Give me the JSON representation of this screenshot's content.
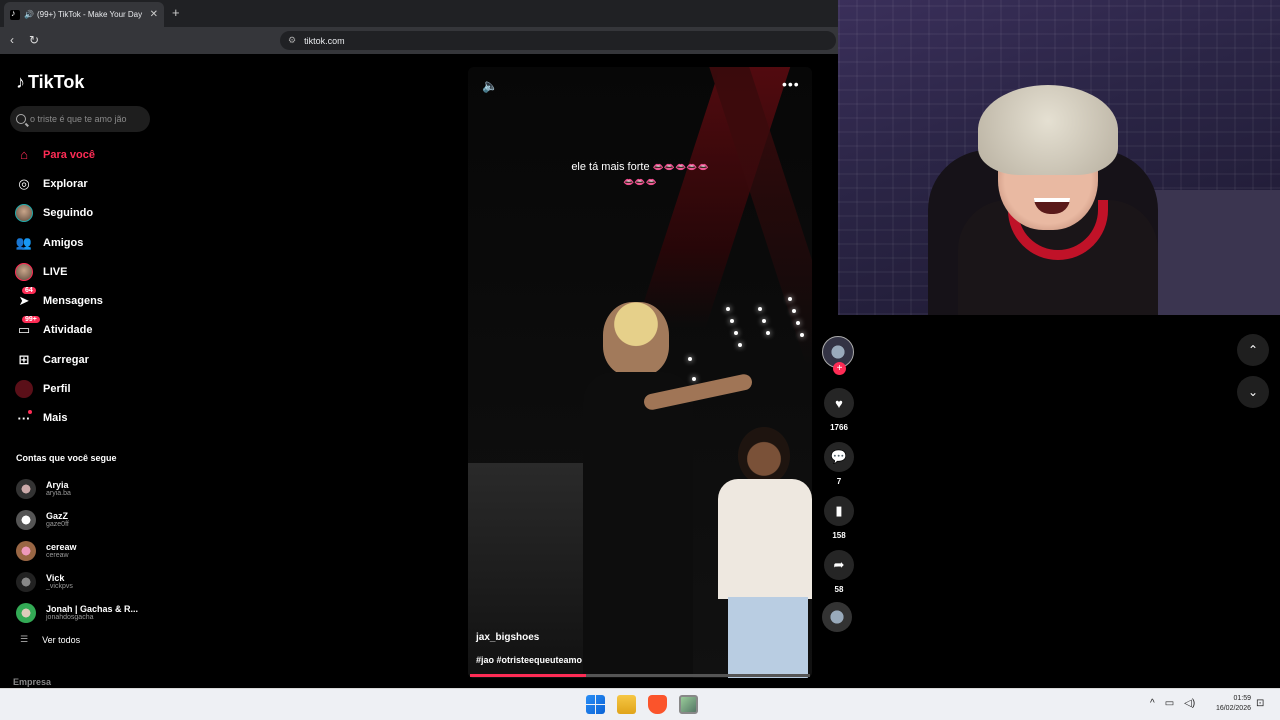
{
  "browser": {
    "tab_title": "(99+) TikTok - Make Your Day",
    "new_tab_label": "+",
    "close_tab_label": "✕",
    "url": "tiktok.com"
  },
  "tiktok": {
    "brand": "TikTok",
    "search_placeholder": "o triste é que te amo jão",
    "nav": [
      {
        "label": "Para você",
        "icon": "home-icon",
        "active": true
      },
      {
        "label": "Explorar",
        "icon": "compass-icon"
      },
      {
        "label": "Seguindo",
        "icon": "avatar-icon"
      },
      {
        "label": "Amigos",
        "icon": "friends-icon"
      },
      {
        "label": "LIVE",
        "icon": "avatar-icon"
      },
      {
        "label": "Mensagens",
        "icon": "messages-icon",
        "badge": "64"
      },
      {
        "label": "Atividade",
        "icon": "activity-icon",
        "badge": "99+"
      },
      {
        "label": "Carregar",
        "icon": "upload-icon"
      },
      {
        "label": "Perfil",
        "icon": "profile-icon"
      },
      {
        "label": "Mais",
        "icon": "more-icon"
      }
    ],
    "following_title": "Contas que você segue",
    "following": [
      {
        "name": "Aryia",
        "handle": "aryia.ba"
      },
      {
        "name": "GazZ",
        "handle": "gaze0ff"
      },
      {
        "name": "cereaw",
        "handle": "cereaw"
      },
      {
        "name": "Vick",
        "handle": "_vickpvs"
      },
      {
        "name": "Jonah | Gachas & R...",
        "handle": "jonahdosgacha"
      }
    ],
    "see_all": "Ver todos",
    "footer_company": "Empresa",
    "video": {
      "overlay_text": "ele tá mais forte",
      "overlay_emojis_1": "👄👄👄👄👄",
      "overlay_emojis_2": "👄👄👄",
      "author": "jax_bigshoes",
      "tags": "#jao #otristeequeuteamo",
      "progress": 0.34,
      "likes": "1766",
      "comments": "7",
      "saves": "158",
      "shares": "58"
    }
  },
  "taskbar": {
    "time": "01:59",
    "date": "16/02/2026"
  },
  "colors": {
    "accent": "#fe2c55"
  }
}
